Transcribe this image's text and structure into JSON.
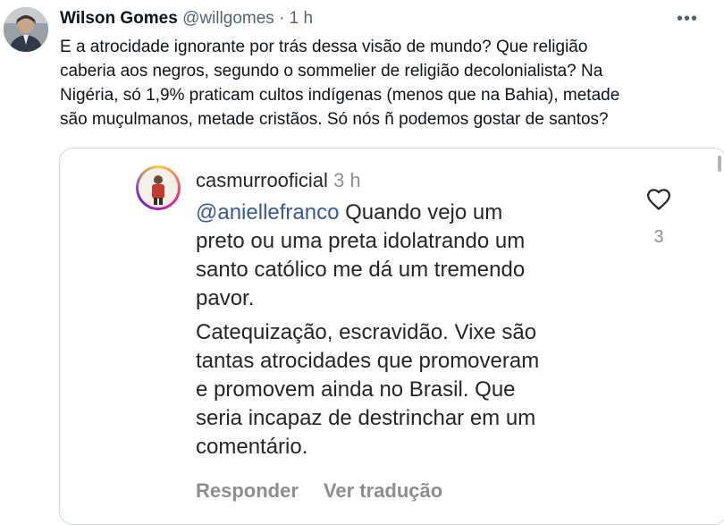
{
  "tweet": {
    "author_name": "Wilson Gomes",
    "handle": "@willgomes",
    "separator": "·",
    "time": "1 h",
    "more_label": "•••",
    "text_lines": [
      "E a atrocidade ignorante por trás dessa visão de mundo? Que religião",
      "caberia aos negros, segundo o sommelier de religião decolonialista? Na",
      "Nigéria, só 1,9% praticam cultos indígenas (menos que na Bahia), metade",
      "são muçulmanos, metade cristãos. Só nós ñ podemos gostar de santos?"
    ]
  },
  "quoted": {
    "username": "casmurrooficial",
    "time": "3 h",
    "mention": "@aniellefranco",
    "paragraph1_first_rest": " Quando vejo um",
    "paragraph1_lines": [
      "preto ou uma preta idolatrando um",
      "santo católico me dá um tremendo",
      "pavor."
    ],
    "paragraph2_lines": [
      "Catequização, escravidão. Vixe são",
      "tantas atrocidades que promoveram",
      "e promovem ainda no Brasil. Que",
      "seria incapaz de destrinchar em um",
      "comentário."
    ],
    "like_count": "3",
    "reply_label": "Responder",
    "translate_label": "Ver tradução"
  },
  "colors": {
    "mention": "#385898",
    "muted": "#8e8e8e"
  }
}
